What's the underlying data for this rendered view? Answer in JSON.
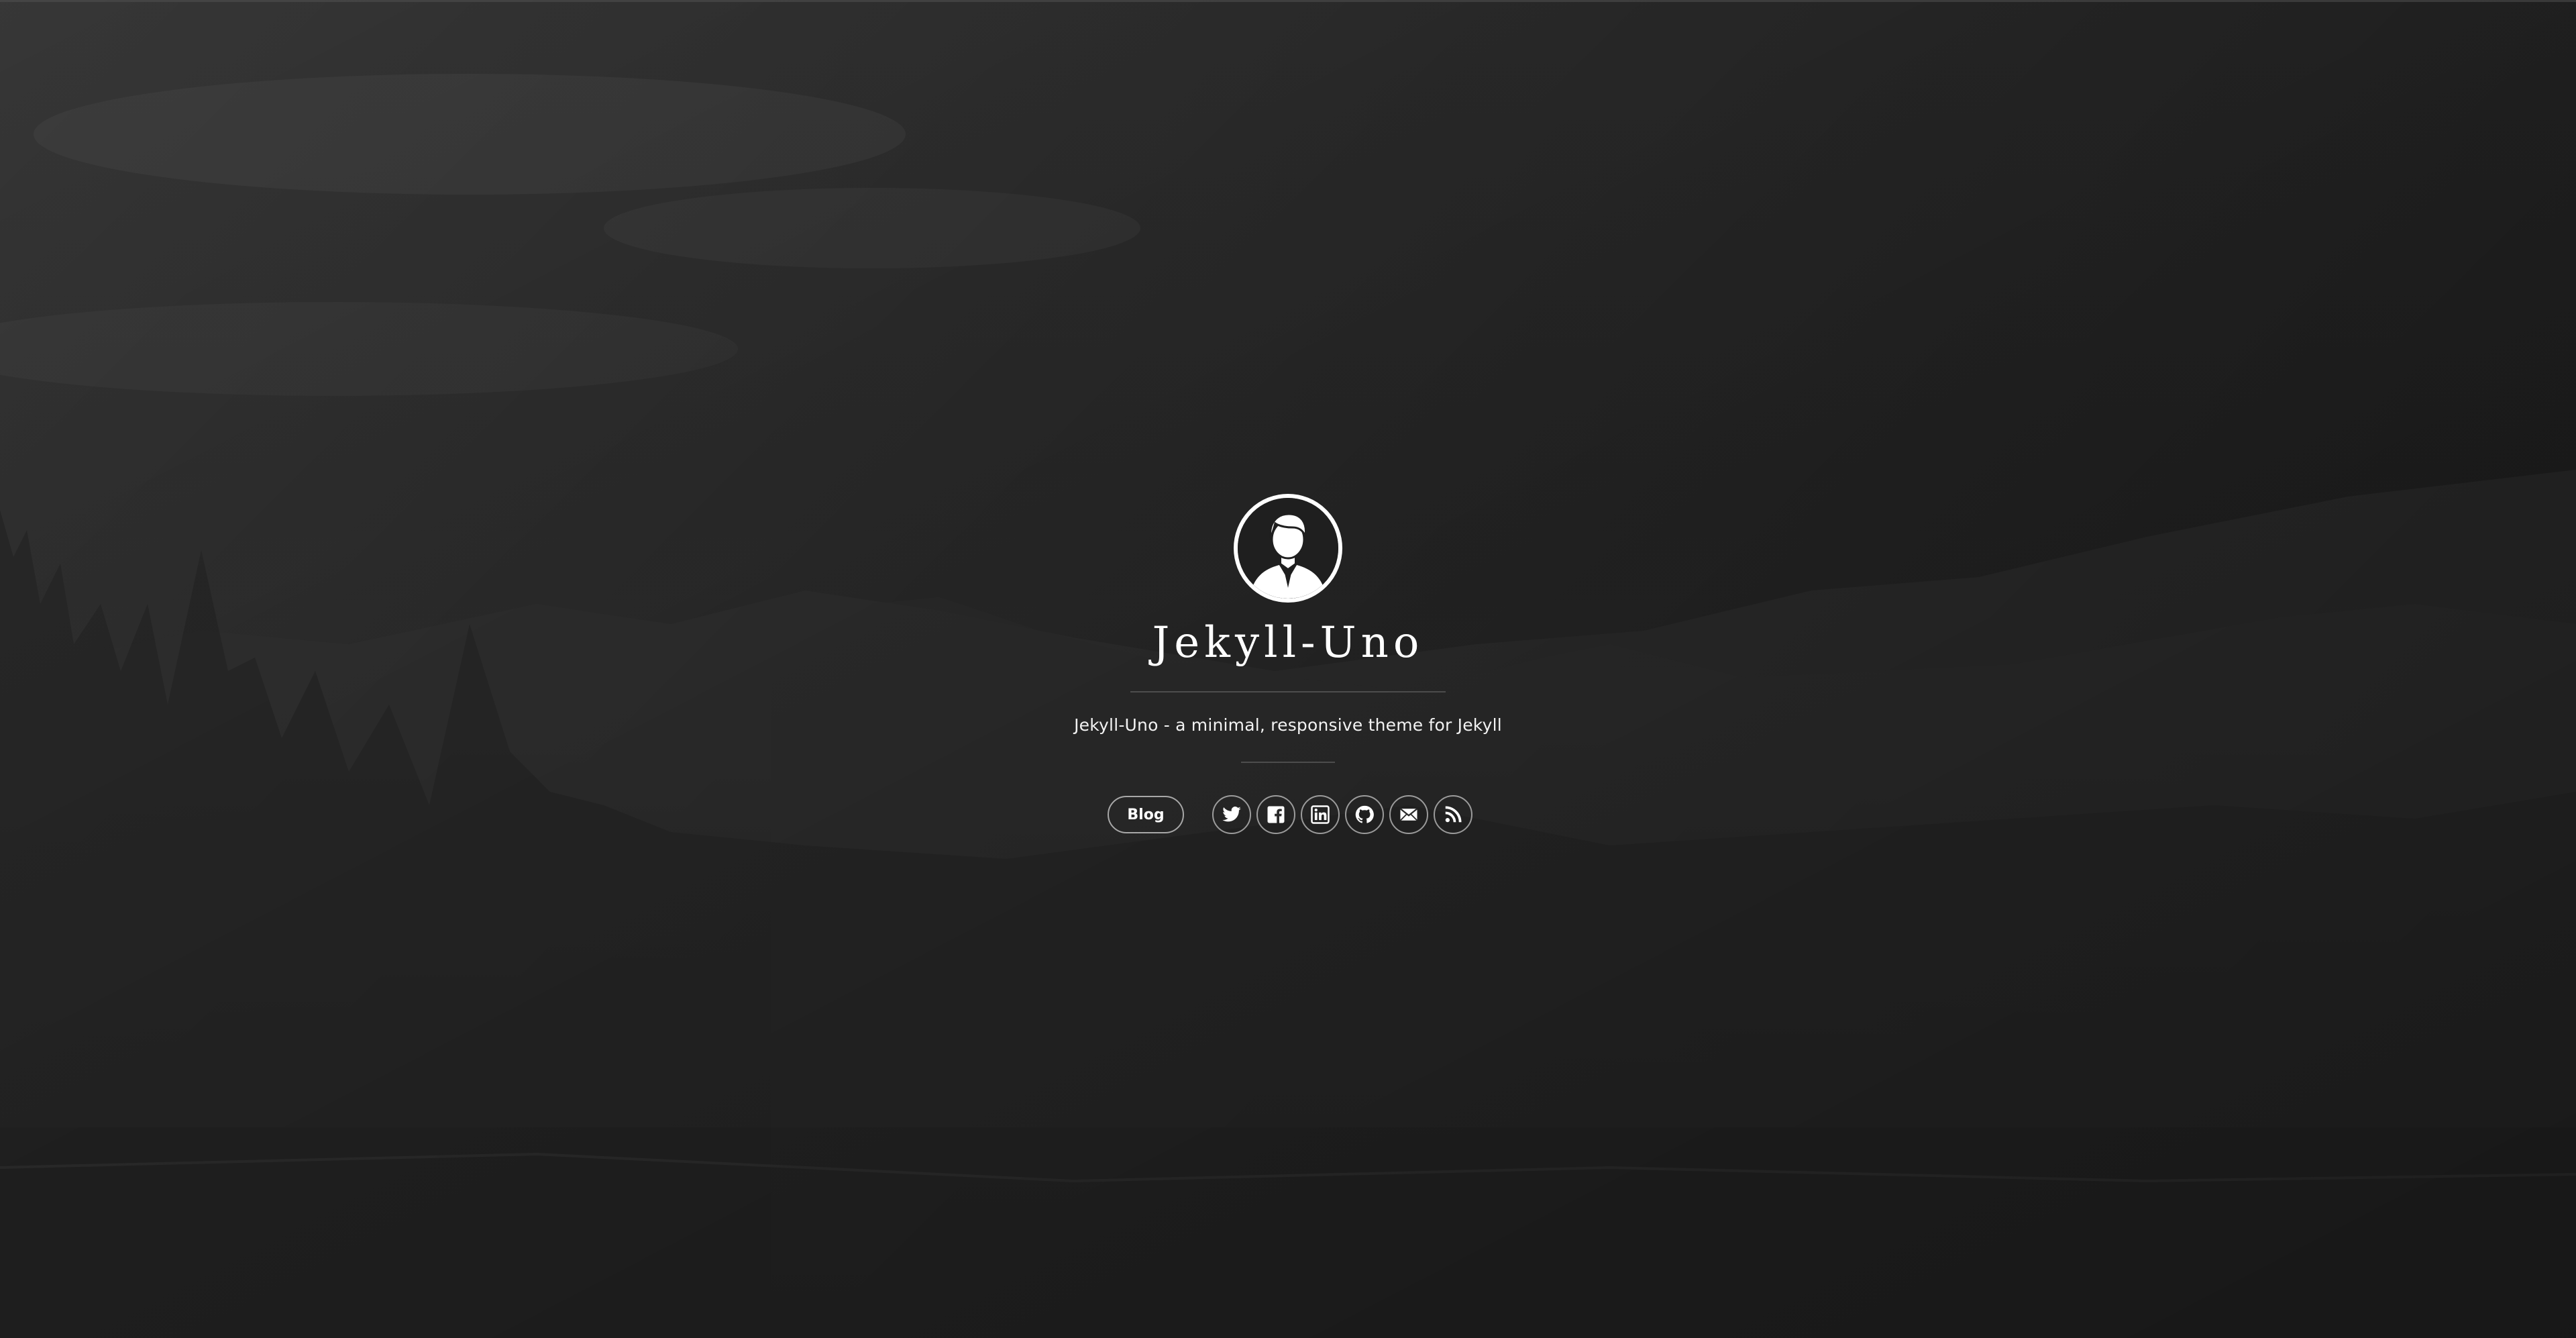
{
  "site": {
    "title": "Jekyll-Uno",
    "tagline": "Jekyll-Uno - a minimal, responsive theme for Jekyll"
  },
  "nav": {
    "blog_label": "Blog"
  },
  "social": [
    {
      "icon": "twitter-icon"
    },
    {
      "icon": "facebook-icon"
    },
    {
      "icon": "linkedin-icon"
    },
    {
      "icon": "github-icon"
    },
    {
      "icon": "email-icon"
    },
    {
      "icon": "rss-icon"
    }
  ],
  "colors": {
    "background": "#2a2a2a",
    "text": "#ffffff",
    "border": "#ffffff"
  }
}
